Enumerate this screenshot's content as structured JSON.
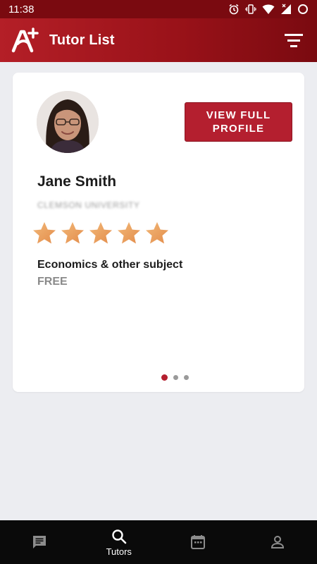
{
  "status_bar": {
    "time": "11:38",
    "icons": [
      "alarm-icon",
      "vibrate-icon",
      "wifi-icon",
      "signal-icon",
      "battery-icon"
    ]
  },
  "app_bar": {
    "logo_icon": "a-plus-logo",
    "title": "Tutor List",
    "filter_icon": "filter-icon"
  },
  "tutor_card": {
    "name": "Jane Smith",
    "school": "CLEMSON UNIVERSITY",
    "rating": 5,
    "rating_max": 5,
    "subject": "Economics & other subject",
    "price": "FREE",
    "view_button_label": "VIEW FULL PROFILE",
    "pagination": {
      "total": 3,
      "active_index": 0
    }
  },
  "bottom_nav": {
    "items": [
      {
        "icon": "chat-icon",
        "label": "",
        "active": false
      },
      {
        "icon": "search-icon",
        "label": "Tutors",
        "active": true
      },
      {
        "icon": "calendar-icon",
        "label": "",
        "active": false
      },
      {
        "icon": "person-icon",
        "label": "",
        "active": false
      }
    ]
  },
  "colors": {
    "brand_red": "#b41f2f",
    "status_bar": "#7a0a10",
    "star": "#eba05f",
    "background": "#ecedf1"
  }
}
